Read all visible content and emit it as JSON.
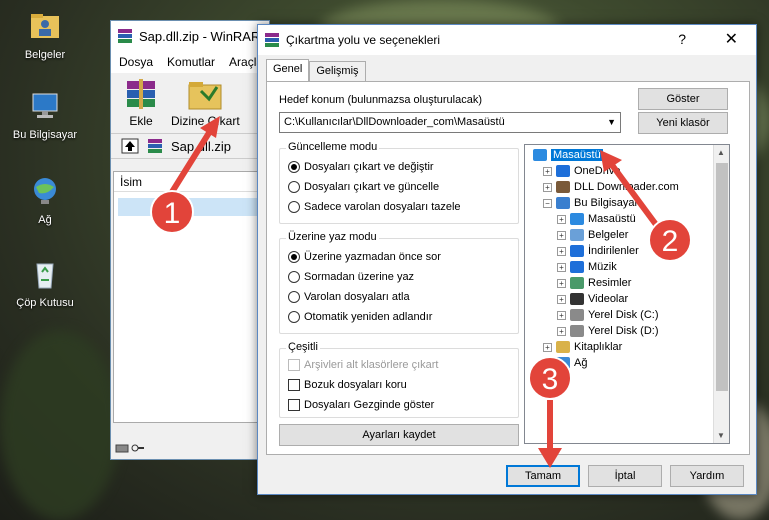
{
  "desktop": {
    "icons": [
      {
        "label": "Belgeler",
        "icon": "folder-user-icon"
      },
      {
        "label": "Bu Bilgisayar",
        "icon": "computer-icon"
      },
      {
        "label": "Ağ",
        "icon": "network-icon"
      },
      {
        "label": "Çöp Kutusu",
        "icon": "recycle-bin-icon"
      }
    ]
  },
  "winrar": {
    "title": "Sap.dll.zip - WinRAR",
    "menu": [
      "Dosya",
      "Komutlar",
      "Araçlar"
    ],
    "toolbar": {
      "add": "Ekle",
      "extract": "Dizine Çıkart"
    },
    "path": "Sap.dll.zip",
    "column_name": "İsim"
  },
  "dialog": {
    "title": "Çıkartma yolu ve seçenekleri",
    "help": "?",
    "close": "✕",
    "tabs": [
      "Genel",
      "Gelişmiş"
    ],
    "destination_label": "Hedef konum (bulunmazsa oluşturulacak)",
    "destination_value": "C:\\Kullanıcılar\\DllDownloader_com\\Masaüstü",
    "show_button": "Göster",
    "new_folder_button": "Yeni klasör",
    "update_mode": {
      "title": "Güncelleme modu",
      "options": [
        "Dosyaları çıkart ve değiştir",
        "Dosyaları çıkart ve güncelle",
        "Sadece varolan dosyaları tazele"
      ],
      "selected": 0
    },
    "overwrite_mode": {
      "title": "Üzerine yaz modu",
      "options": [
        "Üzerine yazmadan önce sor",
        "Sormadan üzerine yaz",
        "Varolan dosyaları atla",
        "Otomatik yeniden adlandır"
      ],
      "selected": 0
    },
    "misc": {
      "title": "Çeşitli",
      "options": [
        "Arşivleri alt klasörlere çıkart",
        "Bozuk dosyaları koru",
        "Dosyaları Gezginde göster"
      ],
      "disabled": [
        true,
        false,
        false
      ],
      "checked": [
        false,
        false,
        false
      ]
    },
    "save_settings_button": "Ayarları kaydet",
    "tree": [
      {
        "label": "Masaüstü",
        "level": 0,
        "icon": "desktop-icon",
        "selected": true,
        "expander": ""
      },
      {
        "label": "OneDrive",
        "level": 1,
        "icon": "onedrive-icon",
        "expander": "+"
      },
      {
        "label": "DLL Downloader.com",
        "level": 1,
        "icon": "user-icon",
        "expander": "+"
      },
      {
        "label": "Bu Bilgisayar",
        "level": 1,
        "icon": "computer-icon",
        "expander": "−"
      },
      {
        "label": "Masaüstü",
        "level": 2,
        "icon": "desktop-icon",
        "expander": "+"
      },
      {
        "label": "Belgeler",
        "level": 2,
        "icon": "documents-icon",
        "expander": "+"
      },
      {
        "label": "İndirilenler",
        "level": 2,
        "icon": "downloads-icon",
        "expander": "+"
      },
      {
        "label": "Müzik",
        "level": 2,
        "icon": "music-icon",
        "expander": "+"
      },
      {
        "label": "Resimler",
        "level": 2,
        "icon": "pictures-icon",
        "expander": "+"
      },
      {
        "label": "Videolar",
        "level": 2,
        "icon": "videos-icon",
        "expander": "+"
      },
      {
        "label": "Yerel Disk (C:)",
        "level": 2,
        "icon": "drive-icon",
        "expander": "+"
      },
      {
        "label": "Yerel Disk (D:)",
        "level": 2,
        "icon": "drive-icon",
        "expander": "+"
      },
      {
        "label": "Kitaplıklar",
        "level": 1,
        "icon": "libraries-icon",
        "expander": "+"
      },
      {
        "label": "Ağ",
        "level": 1,
        "icon": "network-icon",
        "expander": "+"
      }
    ],
    "ok_button": "Tamam",
    "cancel_button": "İptal",
    "help_button": "Yardım"
  },
  "callouts": [
    "1",
    "2",
    "3"
  ],
  "colors": {
    "callout": "#e2443a",
    "accent": "#0078d7",
    "selection": "#0078d7"
  }
}
